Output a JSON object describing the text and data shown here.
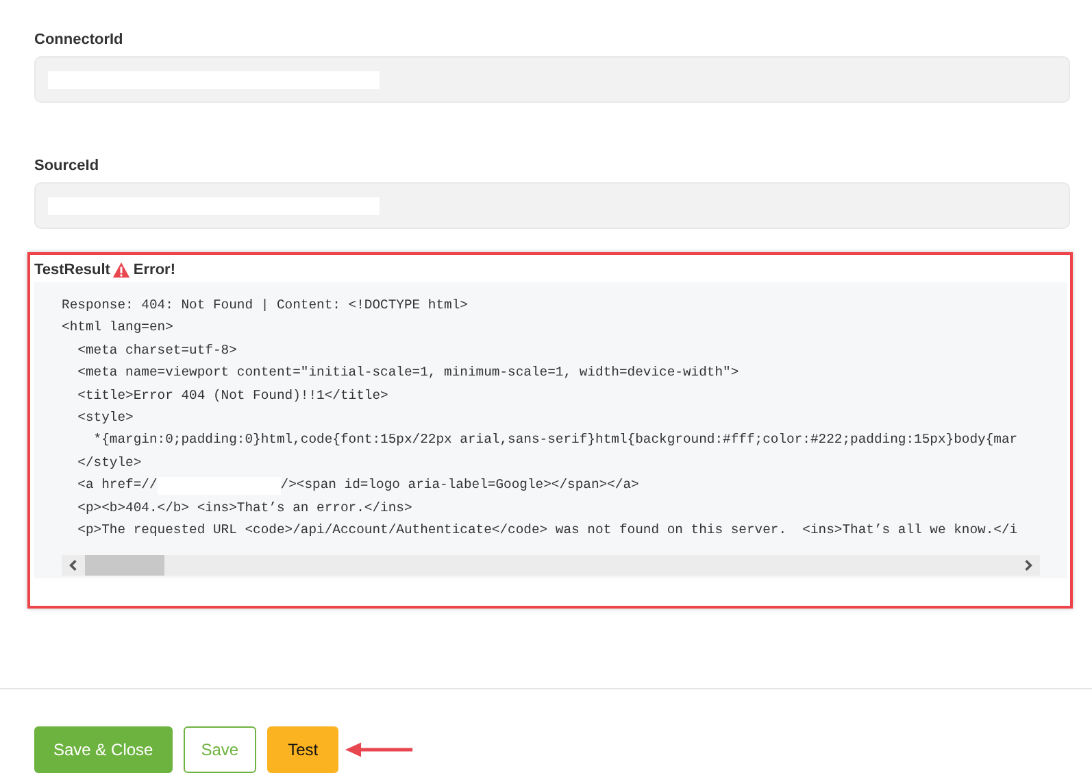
{
  "fields": [
    {
      "label": "ConnectorId",
      "value_redacted": true
    },
    {
      "label": "SourceId",
      "value_redacted": true
    }
  ],
  "test_result": {
    "label": "TestResult",
    "status": "Error!",
    "highlighted": true,
    "lines": [
      {
        "text": "Response: 404: Not Found | Content: <!DOCTYPE html>"
      },
      {
        "text": "<html lang=en>"
      },
      {
        "text": "  <meta charset=utf-8>"
      },
      {
        "text": "  <meta name=viewport content=\"initial-scale=1, minimum-scale=1, width=device-width\">"
      },
      {
        "text": "  <title>Error 404 (Not Found)!!1</title>"
      },
      {
        "text": "  <style>"
      },
      {
        "text": "    *{margin:0;padding:0}html,code{font:15px/22px arial,sans-serif}html{background:#fff;color:#222;padding:15px}body{mar"
      },
      {
        "text": "  </style>"
      },
      {
        "text": "  <a href=//",
        "redacted_tail": "/><span id=logo aria-label=Google></span></a>"
      },
      {
        "text": "  <p><b>404.</b> <ins>That’s an error.</ins>"
      },
      {
        "text": "  <p>The requested URL <code>/api/Account/Authenticate</code> was not found on this server.  <ins>That’s all we know.</i"
      }
    ]
  },
  "buttons": [
    {
      "label": "Save & Close",
      "kind": "primary"
    },
    {
      "label": "Save",
      "kind": "outline"
    },
    {
      "label": "Test",
      "kind": "warning",
      "pointed_at": true
    }
  ]
}
